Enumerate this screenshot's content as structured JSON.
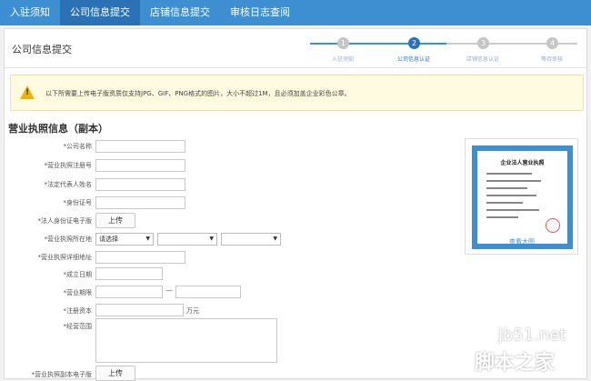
{
  "nav": {
    "tabs": [
      {
        "label": "入驻须知"
      },
      {
        "label": "公司信息提交"
      },
      {
        "label": "店铺信息提交"
      },
      {
        "label": "审核日志查阅"
      }
    ],
    "active_index": 1
  },
  "panel": {
    "title": "公司信息提交"
  },
  "steps": [
    {
      "num": "1",
      "label": "入驻须知",
      "state": "done"
    },
    {
      "num": "2",
      "label": "公司信息认证",
      "state": "active"
    },
    {
      "num": "3",
      "label": "店铺信息认证",
      "state": "pending"
    },
    {
      "num": "4",
      "label": "等待审核",
      "state": "pending"
    }
  ],
  "notice": {
    "icon": "warning-icon",
    "icon_glyph": "!",
    "text": "以下所需要上传电子版资质仅支持JPG、GIF、PNG格式的图片，大小不超过1M，且必须加盖企业彩色公章。"
  },
  "section_title": "营业执照信息（副本）",
  "form": {
    "company_name": "*公司名称",
    "license_no": "*营业执照注册号",
    "legal_rep": "*法定代表人姓名",
    "id_no": "*身份证号",
    "id_photo": "*法人身份证电子版",
    "license_location": "*营业执照所在地",
    "license_address": "*营业执照详细地址",
    "established": "*成立日期",
    "term": "*营业期限",
    "capital": "*注册资本",
    "scope": "*经营范围",
    "license_photo": "*营业执照副本电子版",
    "upload_label": "上传",
    "select_placeholder": "请选择",
    "capital_unit": "万元",
    "term_sep": "—"
  },
  "sample": {
    "title": "企业法人营业执照",
    "view_link": "查看大图"
  },
  "watermark": {
    "line1": "jb51.net",
    "line2": "脚本之家"
  },
  "colors": {
    "primary": "#3d8fd1",
    "active_tab": "#2a72b5",
    "warning": "#f0b400",
    "done_step": "#c5c5c5",
    "stamp": "#e55555"
  }
}
